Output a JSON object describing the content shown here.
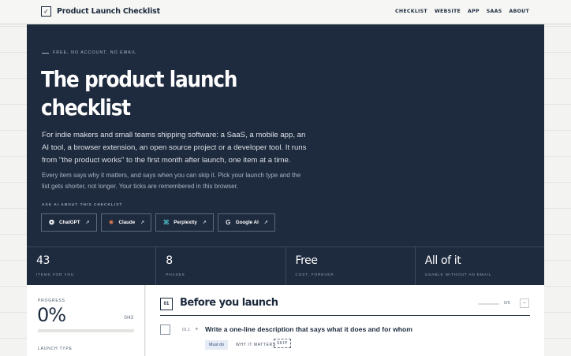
{
  "header": {
    "brand_icon": "✓",
    "brand_title": "Product Launch Checklist",
    "nav": [
      "CHECKLIST",
      "WEBSITE",
      "APP",
      "SAAS",
      "ABOUT"
    ]
  },
  "hero": {
    "eyebrow": "FREE, NO ACCOUNT, NO EMAIL",
    "title": "The product launch checklist",
    "lead": "For indie makers and small teams shipping software: a SaaS, a mobile app, an AI tool, a browser extension, an open source project or a developer tool. It runs from \"the product works\" to the first month after launch, one item at a time.",
    "sub": "Every item says why it matters, and says when you can skip it. Pick your launch type and the list gets shorter, not longer. Your ticks are remembered in this browser.",
    "ask_label": "ASK AI ABOUT THIS CHECKLIST",
    "ai_buttons": [
      {
        "label": "ChatGPT",
        "icon": "chatgpt-icon",
        "glyph": "❂",
        "color": "#ffffff"
      },
      {
        "label": "Claude",
        "icon": "claude-icon",
        "glyph": "✷",
        "color": "#e07a4f"
      },
      {
        "label": "Perplexity",
        "icon": "perplexity-icon",
        "glyph": "⌘",
        "color": "#4fb8c5"
      },
      {
        "label": "Google AI",
        "icon": "google-icon",
        "glyph": "G",
        "color": "#e2e6ea"
      }
    ],
    "arrow": "↗"
  },
  "stats": [
    {
      "value": "43",
      "label": "ITEMS FOR YOU"
    },
    {
      "value": "8",
      "label": "PHASES"
    },
    {
      "value": "Free",
      "label": "COST, FOREVER"
    },
    {
      "value": "All of it",
      "label": "USABLE WITHOUT AN EMAIL"
    }
  ],
  "progress": {
    "label": "PROGRESS",
    "percent": "0%",
    "count": "0/43",
    "fraction": 0,
    "type_label": "LAUNCH TYPE"
  },
  "phase": {
    "number": "01",
    "title": "Before you launch",
    "count": "0/5",
    "toggle": "–"
  },
  "item": {
    "number": "01.1",
    "plus": "+",
    "text": "Write a one-line description that says what it does and for whom",
    "tag_must": "Must do",
    "why": "WHY IT MATTERS",
    "skip": "SKIP"
  },
  "colors": {
    "hero_bg": "#1e2a3d",
    "accent": "#1c2a3d",
    "must_tag_bg": "#e6ecf5"
  }
}
